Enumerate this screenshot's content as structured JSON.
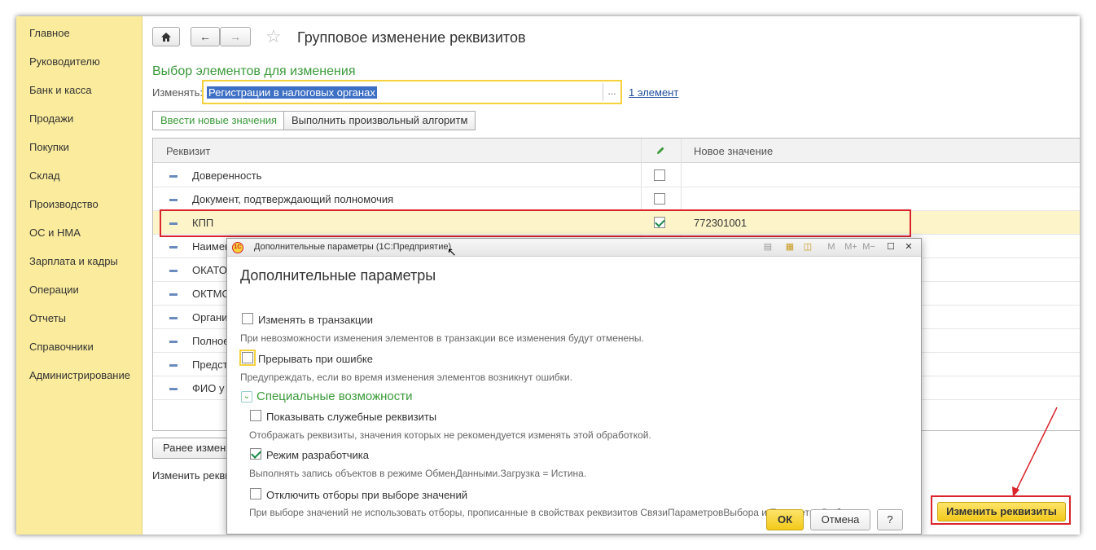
{
  "sidebar": {
    "items": [
      {
        "label": "Главное"
      },
      {
        "label": "Руководителю"
      },
      {
        "label": "Банк и касса"
      },
      {
        "label": "Продажи"
      },
      {
        "label": "Покупки"
      },
      {
        "label": "Склад"
      },
      {
        "label": "Производство"
      },
      {
        "label": "ОС и НМА"
      },
      {
        "label": "Зарплата и кадры"
      },
      {
        "label": "Операции"
      },
      {
        "label": "Отчеты"
      },
      {
        "label": "Справочники"
      },
      {
        "label": "Администрирование"
      }
    ]
  },
  "header": {
    "home_icon": "home-icon",
    "back_icon": "arrow-left-icon",
    "forward_icon": "arrow-right-icon",
    "favorite_icon": "star-icon",
    "title": "Групповое изменение реквизитов"
  },
  "selection": {
    "section_title": "Выбор элементов для изменения",
    "change_label": "Изменять:",
    "change_value": "Регистрации в налоговых органах",
    "select_button": "...",
    "count_link": "1 элемент"
  },
  "tabs": [
    {
      "label": "Ввести новые значения",
      "active": true
    },
    {
      "label": "Выполнить произвольный алгоритм",
      "active": false
    }
  ],
  "grid": {
    "col_attribute": "Реквизит",
    "col_edit_icon": "pencil-icon",
    "col_new_value": "Новое значение",
    "rows": [
      {
        "name": "Доверенность",
        "checked": false,
        "value": ""
      },
      {
        "name": "Документ, подтверждающий полномочия",
        "checked": false,
        "value": ""
      },
      {
        "name": "КПП",
        "checked": true,
        "value": "772301001"
      },
      {
        "name": "Наимен",
        "checked": false,
        "value": ""
      },
      {
        "name": "ОКАТО",
        "checked": false,
        "value": ""
      },
      {
        "name": "ОКТМО",
        "checked": false,
        "value": ""
      },
      {
        "name": "Органи",
        "checked": false,
        "value": ""
      },
      {
        "name": "Полное",
        "checked": false,
        "value": ""
      },
      {
        "name": "Предст",
        "checked": false,
        "value": ""
      },
      {
        "name": "ФИО у",
        "checked": false,
        "value": ""
      }
    ]
  },
  "bottom": {
    "earlier_button": "Ранее измен",
    "change_label": "Изменить рекви",
    "apply_button": "Изменить реквизиты"
  },
  "dialog": {
    "window_title": "Дополнительные параметры  (1С:Предприятие)",
    "heading": "Дополнительные параметры",
    "opt_transaction_label": "Изменять в транзакции",
    "opt_transaction_checked": false,
    "opt_transaction_hint": "При невозможности изменения элементов в транзакции все изменения будут отменены.",
    "opt_stop_label": "Прерывать при ошибке",
    "opt_stop_checked": false,
    "opt_stop_hint": "Предупреждать, если во время изменения элементов возникнут ошибки.",
    "special_title": "Специальные возможности",
    "opt_service_label": "Показывать служебные реквизиты",
    "opt_service_checked": false,
    "opt_service_hint": "Отображать реквизиты, значения которых не рекомендуется изменять этой обработкой.",
    "opt_dev_label": "Режим разработчика",
    "opt_dev_checked": true,
    "opt_dev_hint": "Выполнять запись объектов в режиме ОбменДанными.Загрузка = Истина.",
    "opt_filters_label": "Отключить отборы при выборе значений",
    "opt_filters_checked": false,
    "opt_filters_hint": "При выборе значений не использовать отборы, прописанные в свойствах реквизитов СвязиПараметровВыбора и ПараметрыВыбора.",
    "ok_button": "ОК",
    "cancel_button": "Отмена",
    "help_button": "?",
    "toolbar_m": "M",
    "toolbar_mplus": "M+",
    "toolbar_mminus": "M−"
  },
  "colors": {
    "sidebar_bg": "#fbec9d",
    "accent_green": "#3a9a3a",
    "highlight_red": "#d9242c",
    "primary_yellow": "#f2c91a"
  }
}
